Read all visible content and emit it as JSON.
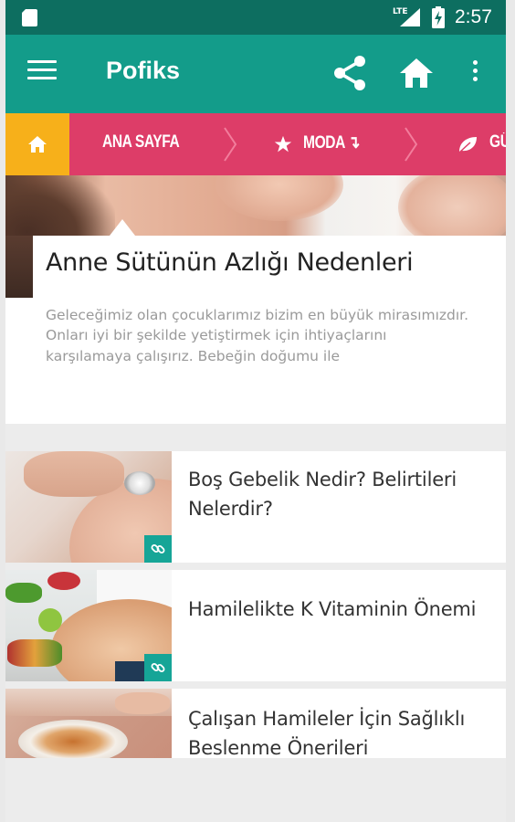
{
  "status_bar": {
    "time": "2:57",
    "network": "LTE"
  },
  "app_bar": {
    "title": "Pofiks",
    "icons": [
      "menu-icon",
      "share-icon",
      "home-icon",
      "more-vert-icon"
    ],
    "color": "#139c8a"
  },
  "category_nav": {
    "items": [
      {
        "label": "ANA SAYFA",
        "icon": ""
      },
      {
        "label": "MODA ↴",
        "icon": "star-icon"
      },
      {
        "label": "GÜ",
        "icon": "leaf-icon"
      }
    ],
    "color": "#dd3d68",
    "home_color": "#f7b01a"
  },
  "featured": {
    "title": "Anne Sütünün Azlığı Nedenleri",
    "excerpt": "Geleceğimiz olan çocuklarımız bizim en büyük mirasımızdır. Onları iyi bir şekilde yetiştirmek için ihtiyaçlarını karşılamaya çalışırız. Bebeğin doğumu ile"
  },
  "articles": [
    {
      "title": "Boş Gebelik Nedir? Belirtileri Nelerdir?",
      "has_link_badge": true
    },
    {
      "title": "Hamilelikte K Vitaminin Önemi",
      "has_link_badge": true
    },
    {
      "title": "Çalışan Hamileler İçin Sağlıklı Beslenme Önerileri",
      "has_link_badge": false
    }
  ]
}
